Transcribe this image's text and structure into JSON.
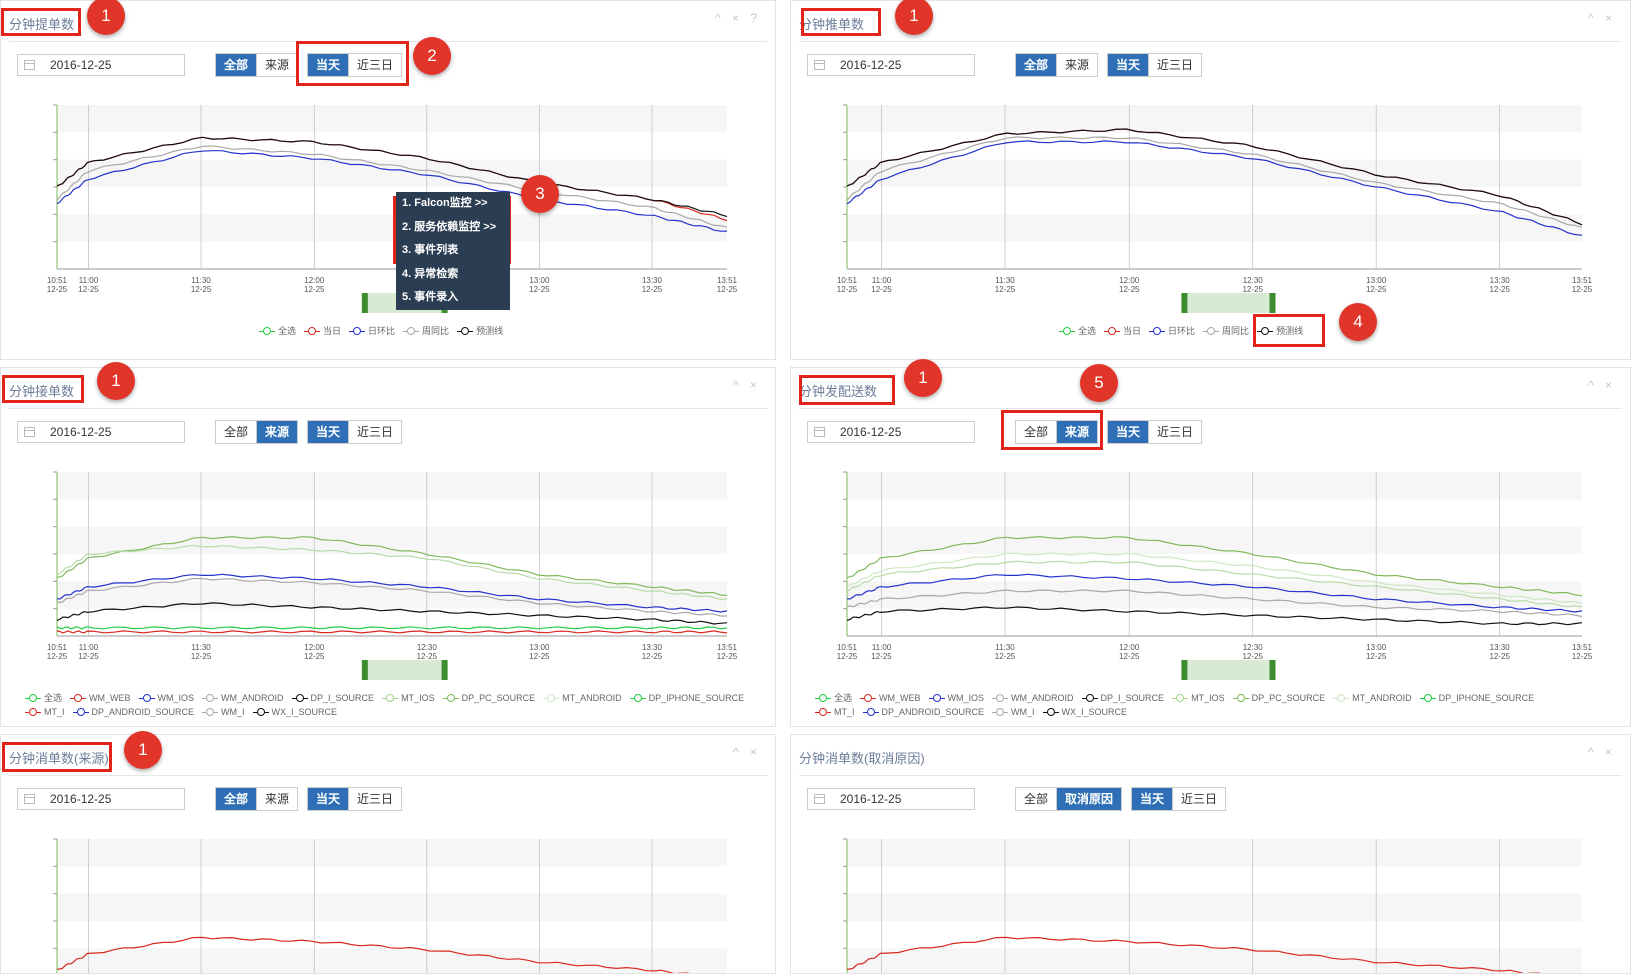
{
  "colors": {
    "active_btn": "#2e6fb5",
    "highlight": "#e3241b",
    "badge": "#e2352a",
    "menu_bg": "#2b3d52"
  },
  "icons": {
    "collapse": "chevron-up-icon",
    "close": "close-icon",
    "help": "question-icon",
    "date": "calendar-icon"
  },
  "panels": [
    {
      "title": "分钟提单数",
      "date": "2016-12-25",
      "group1": [
        "全部",
        "来源"
      ],
      "group2": [
        "当天",
        "近三日"
      ],
      "ctrls": "^ × ?"
    },
    {
      "title": "分钟推单数",
      "date": "2016-12-25",
      "group1": [
        "全部",
        "来源"
      ],
      "group2": [
        "当天",
        "近三日"
      ],
      "ctrls": "^ ×"
    },
    {
      "title": "分钟接单数",
      "date": "2016-12-25",
      "group1": [
        "全部",
        "来源"
      ],
      "group2": [
        "当天",
        "近三日"
      ],
      "ctrls": "^ ×"
    },
    {
      "title": "分钟发配送数",
      "date": "2016-12-25",
      "group1": [
        "全部",
        "来源"
      ],
      "group2": [
        "当天",
        "近三日"
      ],
      "ctrls": "^ ×"
    },
    {
      "title": "分钟消单数(来源)",
      "date": "2016-12-25",
      "group1": [
        "全部",
        "来源"
      ],
      "group2": [
        "当天",
        "近三日"
      ],
      "ctrls": "^ ×"
    },
    {
      "title": "分钟消单数(取消原因)",
      "date": "2016-12-25",
      "group1": [
        "全部",
        "取消原因"
      ],
      "group2": [
        "当天",
        "近三日"
      ],
      "ctrls": "^ ×"
    }
  ],
  "x_ticks": [
    {
      "time": "10:51",
      "day": "12-25"
    },
    {
      "time": "11:00",
      "day": "12-25"
    },
    {
      "time": "11:30",
      "day": "12-25"
    },
    {
      "time": "12:00",
      "day": "12-25"
    },
    {
      "time": "12:30",
      "day": "12-25"
    },
    {
      "time": "13:00",
      "day": "12-25"
    },
    {
      "time": "13:30",
      "day": "12-25"
    },
    {
      "time": "13:51",
      "day": "12-25"
    }
  ],
  "legend_small": [
    "全选",
    "当日",
    "日环比",
    "周同比",
    "预测线"
  ],
  "legend_source_row1": [
    "全选",
    "WM_WEB",
    "WM_IOS",
    "WM_ANDROID",
    "DP_I_SOURCE",
    "MT_IOS",
    "DP_PC_SOURCE",
    "MT_ANDROID",
    "DP_IPHONE_SOURCE"
  ],
  "legend_source_row2": [
    "MT_I",
    "DP_ANDROID_SOURCE",
    "WM_I",
    "WX_I_SOURCE"
  ],
  "context_menu": [
    "1. Falcon监控 >>",
    "2. 服务依赖监控 >>",
    "3. 事件列表",
    "4. 异常检索",
    "5. 事件录入"
  ],
  "badges": [
    "1",
    "2",
    "3",
    "4",
    "5"
  ],
  "chart_data": [
    {
      "type": "line",
      "panel": "分钟提单数",
      "x": [
        "10:51",
        "11:00",
        "11:30",
        "12:00",
        "12:30",
        "13:00",
        "13:30",
        "13:51"
      ],
      "series": [
        {
          "name": "当日",
          "values": [
            20,
            26,
            32,
            31,
            27,
            21,
            17,
            12
          ]
        },
        {
          "name": "日环比",
          "values": [
            16,
            22,
            29,
            27,
            23,
            17,
            13,
            9
          ]
        },
        {
          "name": "周同比",
          "values": [
            17,
            24,
            30,
            28,
            24,
            19,
            15,
            10
          ]
        },
        {
          "name": "预测线",
          "values": [
            20,
            26,
            32,
            31,
            27,
            21,
            17,
            13
          ]
        }
      ]
    },
    {
      "type": "line",
      "panel": "分钟推单数",
      "x": [
        "10:51",
        "11:00",
        "11:30",
        "12:00",
        "12:30",
        "13:00",
        "13:30",
        "13:51"
      ],
      "series": [
        {
          "name": "当日",
          "values": [
            20,
            26,
            33,
            34,
            30,
            23,
            18,
            11
          ]
        },
        {
          "name": "日环比",
          "values": [
            16,
            22,
            31,
            31,
            27,
            20,
            14,
            8
          ]
        },
        {
          "name": "周同比",
          "values": [
            17,
            24,
            32,
            32,
            28,
            21,
            16,
            10
          ]
        },
        {
          "name": "预测线",
          "values": [
            20,
            26,
            33,
            34,
            30,
            23,
            18,
            11
          ]
        }
      ]
    },
    {
      "type": "line",
      "panel": "分钟接单数",
      "x": [
        "10:51",
        "11:00",
        "11:30",
        "12:00",
        "12:30",
        "13:00",
        "13:30",
        "13:51"
      ],
      "series": [
        {
          "name": "DP_PC_SOURCE",
          "values": [
            14,
            19,
            24,
            24,
            20,
            15,
            12,
            10
          ]
        },
        {
          "name": "MT_IOS",
          "values": [
            15,
            20,
            22,
            21,
            19,
            14,
            11,
            9
          ]
        },
        {
          "name": "WM_IOS",
          "values": [
            9,
            12,
            15,
            14,
            12,
            9,
            7,
            6
          ]
        },
        {
          "name": "WM_ANDROID",
          "values": [
            8,
            11,
            14,
            13,
            11,
            8,
            6,
            5
          ]
        },
        {
          "name": "DP_I_SOURCE",
          "values": [
            4,
            6,
            8,
            7,
            6,
            5,
            4,
            3
          ]
        },
        {
          "name": "WM_WEB",
          "values": [
            1,
            1,
            1,
            1,
            1,
            1,
            1,
            1
          ]
        },
        {
          "name": "DP_IPHONE_SOURCE",
          "values": [
            2,
            2,
            2,
            2,
            2,
            2,
            2,
            2
          ]
        }
      ]
    },
    {
      "type": "line",
      "panel": "分钟发配送数",
      "x": [
        "10:51",
        "11:00",
        "11:30",
        "12:00",
        "12:30",
        "13:00",
        "13:30",
        "13:51"
      ],
      "series": [
        {
          "name": "DP_PC_SOURCE",
          "values": [
            14,
            19,
            24,
            24,
            20,
            15,
            12,
            10
          ]
        },
        {
          "name": "MT_ANDROID",
          "values": [
            12,
            16,
            20,
            20,
            17,
            13,
            10,
            8
          ]
        },
        {
          "name": "MT_IOS",
          "values": [
            11,
            15,
            18,
            18,
            15,
            12,
            9,
            7
          ]
        },
        {
          "name": "WM_IOS",
          "values": [
            9,
            12,
            15,
            14,
            12,
            9,
            7,
            6
          ]
        },
        {
          "name": "WM_ANDROID",
          "values": [
            7,
            9,
            11,
            11,
            9,
            7,
            6,
            5
          ]
        },
        {
          "name": "DP_I_SOURCE",
          "values": [
            4,
            6,
            7,
            6,
            5,
            4,
            3,
            3
          ]
        }
      ]
    }
  ]
}
